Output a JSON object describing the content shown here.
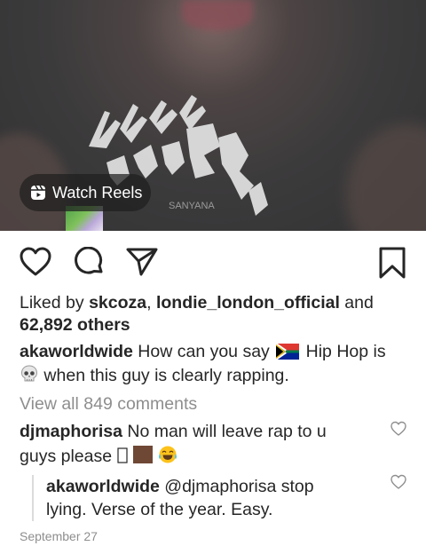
{
  "media": {
    "reels_label": "Watch Reels",
    "reels_icon": "reels-icon"
  },
  "actions": {
    "like_icon": "heart-icon",
    "comment_icon": "comment-icon",
    "share_icon": "send-icon",
    "save_icon": "bookmark-icon"
  },
  "likes": {
    "prefix": "Liked by",
    "user1": "skcoza",
    "sep": ",",
    "user2": "londie_london_official",
    "and": "and",
    "others": "62,892 others"
  },
  "caption": {
    "username": "akaworldwide",
    "text_part1": "How can you say",
    "flag_icon": "south-africa-flag-icon",
    "text_part2": "Hip Hop is",
    "skull_icon": "skull-icon",
    "text_part3": "when this guy is clearly rapping."
  },
  "view_all": "View all 849 comments",
  "comments": [
    {
      "username": "djmaphorisa",
      "text_line1": "No man will leave rap to u",
      "text_line2": "guys please",
      "emoji_icons": [
        "missing-glyph-icon",
        "brown-square-icon",
        "tears-of-joy-icon"
      ]
    }
  ],
  "reply": {
    "username": "akaworldwide",
    "mention": "@djmaphorisa",
    "text_line1": "stop",
    "text_line2": "lying. Verse of the year. Easy."
  },
  "date": "September 27",
  "colors": {
    "text": "#262626",
    "muted": "#8e8e8e",
    "pill_bg": "#1e1e1e"
  }
}
